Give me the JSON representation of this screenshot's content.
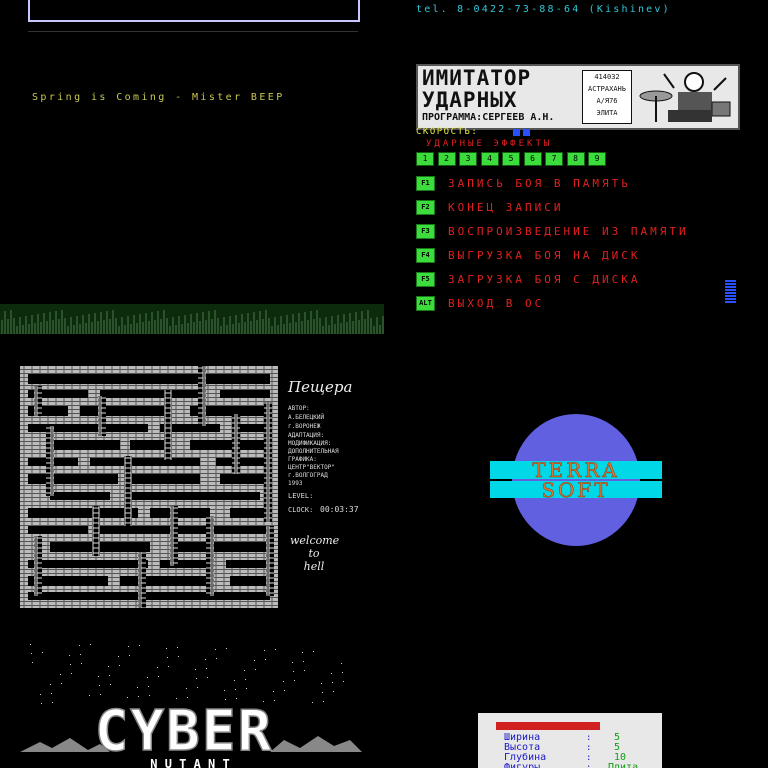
{
  "panels": {
    "spring": {
      "title": "Spring is Coming - Mister BEEP"
    },
    "drum": {
      "phone": "tel. 8-0422-73-88-64 (Kishinev)",
      "banner_line1": "ИМИТАТОР",
      "banner_line2": "УДАРНЫХ",
      "banner_line3": "ПРОГРАММА:СЕРГЕЕВ А.Н.",
      "banner_info": [
        "414032",
        "АСТРАХАНЬ",
        "А/Я76",
        "ЭЛИТА"
      ],
      "speed_label": "СКОРОСТЬ:",
      "effects_label": "УДАРНЫЕ ЭФФЕКТЫ",
      "effect_keys": [
        "1",
        "2",
        "3",
        "4",
        "5",
        "6",
        "7",
        "8",
        "9"
      ],
      "menu": [
        {
          "key": "F1",
          "label": "ЗАПИСЬ БОЯ В ПАМЯТЬ"
        },
        {
          "key": "F2",
          "label": "КОНЕЦ ЗАПИСИ"
        },
        {
          "key": "F3",
          "label": "ВОСПРОИЗВЕДЕНИЕ ИЗ ПАМЯТИ"
        },
        {
          "key": "F4",
          "label": "ВЫГРУЗКА БОЯ НА ДИСК"
        },
        {
          "key": "F5",
          "label": "ЗАГРУЗКА БОЯ С ДИСКА"
        },
        {
          "key": "ALT",
          "label": "ВЫХОД В ОС"
        }
      ]
    },
    "cave": {
      "title": "Пещера",
      "author_lines": [
        "АВТОР:",
        "А.БЕЛЕЦКИЙ",
        "г.ВОРОНЕЖ"
      ],
      "adapt_lines": [
        "АДАПТАЦИЯ:",
        "МОДИФИКАЦИЯ:",
        "ДОПОЛНИТЕЛЬНАЯ",
        "ГРАФИКА:",
        "ЦЕНТР\"ВЕКТОР\"",
        "г.ВОЛГОГРАД",
        "1993"
      ],
      "level_label": "LEVEL:",
      "clock_label": "CLOCK:",
      "clock_value": "00:03:37",
      "welcome_lines": [
        "welcome",
        "to",
        "hell"
      ]
    },
    "terra": {
      "line1": "TERRA",
      "line2": "SOFT",
      "colors": {
        "globe": "#6060e0",
        "band": "#00d8e8",
        "text": "#e07830"
      }
    },
    "cyber": {
      "logo": "CYBER",
      "sub": "N U T A N T"
    },
    "settings": {
      "header": "",
      "rows": [
        {
          "label": "Ширина",
          "value": "5"
        },
        {
          "label": "Высота",
          "value": "5"
        },
        {
          "label": "Глубина",
          "value": "10"
        },
        {
          "label": "Фигуры",
          "value": "Плита"
        }
      ]
    }
  }
}
